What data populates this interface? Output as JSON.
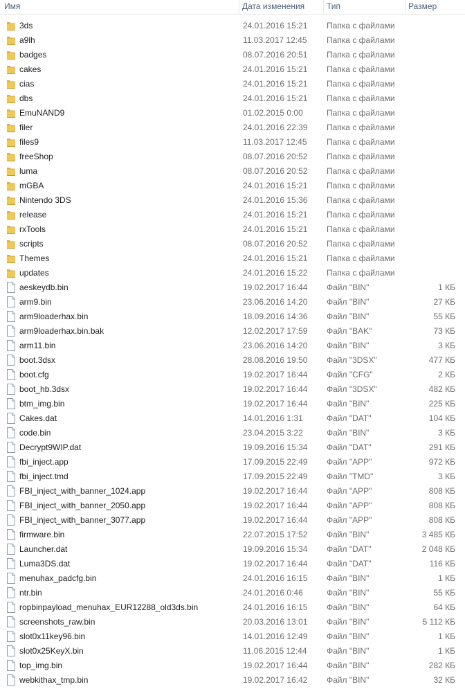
{
  "header": {
    "name": "Имя",
    "date": "Дата изменения",
    "type": "Тип",
    "size": "Размер"
  },
  "rows": [
    {
      "name": "3ds",
      "date": "24.01.2016 15:21",
      "type": "Папка с файлами",
      "size": "",
      "icon": "folder-icon"
    },
    {
      "name": "a9lh",
      "date": "11.03.2017 12:45",
      "type": "Папка с файлами",
      "size": "",
      "icon": "folder-icon"
    },
    {
      "name": "badges",
      "date": "08.07.2016 20:51",
      "type": "Папка с файлами",
      "size": "",
      "icon": "folder-icon"
    },
    {
      "name": "cakes",
      "date": "24.01.2016 15:21",
      "type": "Папка с файлами",
      "size": "",
      "icon": "folder-icon"
    },
    {
      "name": "cias",
      "date": "24.01.2016 15:21",
      "type": "Папка с файлами",
      "size": "",
      "icon": "folder-icon"
    },
    {
      "name": "dbs",
      "date": "24.01.2016 15:21",
      "type": "Папка с файлами",
      "size": "",
      "icon": "folder-icon"
    },
    {
      "name": "EmuNAND9",
      "date": "01.02.2015 0:00",
      "type": "Папка с файлами",
      "size": "",
      "icon": "folder-icon"
    },
    {
      "name": "filer",
      "date": "24.01.2016 22:39",
      "type": "Папка с файлами",
      "size": "",
      "icon": "folder-icon"
    },
    {
      "name": "files9",
      "date": "11.03.2017 12:45",
      "type": "Папка с файлами",
      "size": "",
      "icon": "folder-icon"
    },
    {
      "name": "freeShop",
      "date": "08.07.2016 20:52",
      "type": "Папка с файлами",
      "size": "",
      "icon": "folder-icon"
    },
    {
      "name": "luma",
      "date": "08.07.2016 20:52",
      "type": "Папка с файлами",
      "size": "",
      "icon": "folder-icon"
    },
    {
      "name": "mGBA",
      "date": "24.01.2016 15:21",
      "type": "Папка с файлами",
      "size": "",
      "icon": "folder-icon"
    },
    {
      "name": "Nintendo 3DS",
      "date": "24.01.2016 15:36",
      "type": "Папка с файлами",
      "size": "",
      "icon": "folder-icon"
    },
    {
      "name": "release",
      "date": "24.01.2016 15:21",
      "type": "Папка с файлами",
      "size": "",
      "icon": "folder-icon"
    },
    {
      "name": "rxTools",
      "date": "24.01.2016 15:21",
      "type": "Папка с файлами",
      "size": "",
      "icon": "folder-icon"
    },
    {
      "name": "scripts",
      "date": "08.07.2016 20:52",
      "type": "Папка с файлами",
      "size": "",
      "icon": "folder-icon"
    },
    {
      "name": "Themes",
      "date": "24.01.2016 15:21",
      "type": "Папка с файлами",
      "size": "",
      "icon": "folder-icon"
    },
    {
      "name": "updates",
      "date": "24.01.2016 15:22",
      "type": "Папка с файлами",
      "size": "",
      "icon": "folder-icon"
    },
    {
      "name": "aeskeydb.bin",
      "date": "19.02.2017 16:44",
      "type": "Файл \"BIN\"",
      "size": "1 КБ",
      "icon": "file-icon"
    },
    {
      "name": "arm9.bin",
      "date": "23.06.2016 14:20",
      "type": "Файл \"BIN\"",
      "size": "27 КБ",
      "icon": "file-icon"
    },
    {
      "name": "arm9loaderhax.bin",
      "date": "18.09.2016 14:36",
      "type": "Файл \"BIN\"",
      "size": "55 КБ",
      "icon": "file-icon"
    },
    {
      "name": "arm9loaderhax.bin.bak",
      "date": "12.02.2017 17:59",
      "type": "Файл \"BAK\"",
      "size": "73 КБ",
      "icon": "file-icon"
    },
    {
      "name": "arm11.bin",
      "date": "23.06.2016 14:20",
      "type": "Файл \"BIN\"",
      "size": "3 КБ",
      "icon": "file-icon"
    },
    {
      "name": "boot.3dsx",
      "date": "28.08.2016 19:50",
      "type": "Файл \"3DSX\"",
      "size": "477 КБ",
      "icon": "file-icon"
    },
    {
      "name": "boot.cfg",
      "date": "19.02.2017 16:44",
      "type": "Файл \"CFG\"",
      "size": "2 КБ",
      "icon": "file-icon"
    },
    {
      "name": "boot_hb.3dsx",
      "date": "19.02.2017 16:44",
      "type": "Файл \"3DSX\"",
      "size": "482 КБ",
      "icon": "file-icon"
    },
    {
      "name": "btm_img.bin",
      "date": "19.02.2017 16:44",
      "type": "Файл \"BIN\"",
      "size": "225 КБ",
      "icon": "file-icon"
    },
    {
      "name": "Cakes.dat",
      "date": "14.01.2016 1:31",
      "type": "Файл \"DAT\"",
      "size": "104 КБ",
      "icon": "file-icon"
    },
    {
      "name": "code.bin",
      "date": "23.04.2015 3:22",
      "type": "Файл \"BIN\"",
      "size": "3 КБ",
      "icon": "file-icon"
    },
    {
      "name": "Decrypt9WIP.dat",
      "date": "19.09.2016 15:34",
      "type": "Файл \"DAT\"",
      "size": "291 КБ",
      "icon": "file-icon"
    },
    {
      "name": "fbi_inject.app",
      "date": "17.09.2015 22:49",
      "type": "Файл \"APP\"",
      "size": "972 КБ",
      "icon": "file-icon"
    },
    {
      "name": "fbi_inject.tmd",
      "date": "17.09.2015 22:49",
      "type": "Файл \"TMD\"",
      "size": "3 КБ",
      "icon": "file-icon"
    },
    {
      "name": "FBI_inject_with_banner_1024.app",
      "date": "19.02.2017 16:44",
      "type": "Файл \"APP\"",
      "size": "808 КБ",
      "icon": "file-icon"
    },
    {
      "name": "FBI_inject_with_banner_2050.app",
      "date": "19.02.2017 16:44",
      "type": "Файл \"APP\"",
      "size": "808 КБ",
      "icon": "file-icon"
    },
    {
      "name": "FBI_inject_with_banner_3077.app",
      "date": "19.02.2017 16:44",
      "type": "Файл \"APP\"",
      "size": "808 КБ",
      "icon": "file-icon"
    },
    {
      "name": "firmware.bin",
      "date": "22.07.2015 17:52",
      "type": "Файл \"BIN\"",
      "size": "3 485 КБ",
      "icon": "file-icon"
    },
    {
      "name": "Launcher.dat",
      "date": "19.09.2016 15:34",
      "type": "Файл \"DAT\"",
      "size": "2 048 КБ",
      "icon": "file-icon"
    },
    {
      "name": "Luma3DS.dat",
      "date": "19.02.2017 16:44",
      "type": "Файл \"DAT\"",
      "size": "116 КБ",
      "icon": "file-icon"
    },
    {
      "name": "menuhax_padcfg.bin",
      "date": "24.01.2016 16:15",
      "type": "Файл \"BIN\"",
      "size": "1 КБ",
      "icon": "file-icon"
    },
    {
      "name": "ntr.bin",
      "date": "24.01.2016 0:46",
      "type": "Файл \"BIN\"",
      "size": "55 КБ",
      "icon": "file-icon"
    },
    {
      "name": "ropbinpayload_menuhax_EUR12288_old3ds.bin",
      "date": "24.01.2016 16:15",
      "type": "Файл \"BIN\"",
      "size": "64 КБ",
      "icon": "file-icon"
    },
    {
      "name": "screenshots_raw.bin",
      "date": "20.03.2016 13:01",
      "type": "Файл \"BIN\"",
      "size": "5 112 КБ",
      "icon": "file-icon"
    },
    {
      "name": "slot0x11key96.bin",
      "date": "14.01.2016 12:49",
      "type": "Файл \"BIN\"",
      "size": "1 КБ",
      "icon": "file-icon"
    },
    {
      "name": "slot0x25KeyX.bin",
      "date": "11.06.2015 12:44",
      "type": "Файл \"BIN\"",
      "size": "1 КБ",
      "icon": "file-icon"
    },
    {
      "name": "top_img.bin",
      "date": "19.02.2017 16:44",
      "type": "Файл \"BIN\"",
      "size": "282 КБ",
      "icon": "file-icon"
    },
    {
      "name": "webkithax_tmp.bin",
      "date": "19.02.2017 16:42",
      "type": "Файл \"BIN\"",
      "size": "32 КБ",
      "icon": "file-icon"
    }
  ]
}
